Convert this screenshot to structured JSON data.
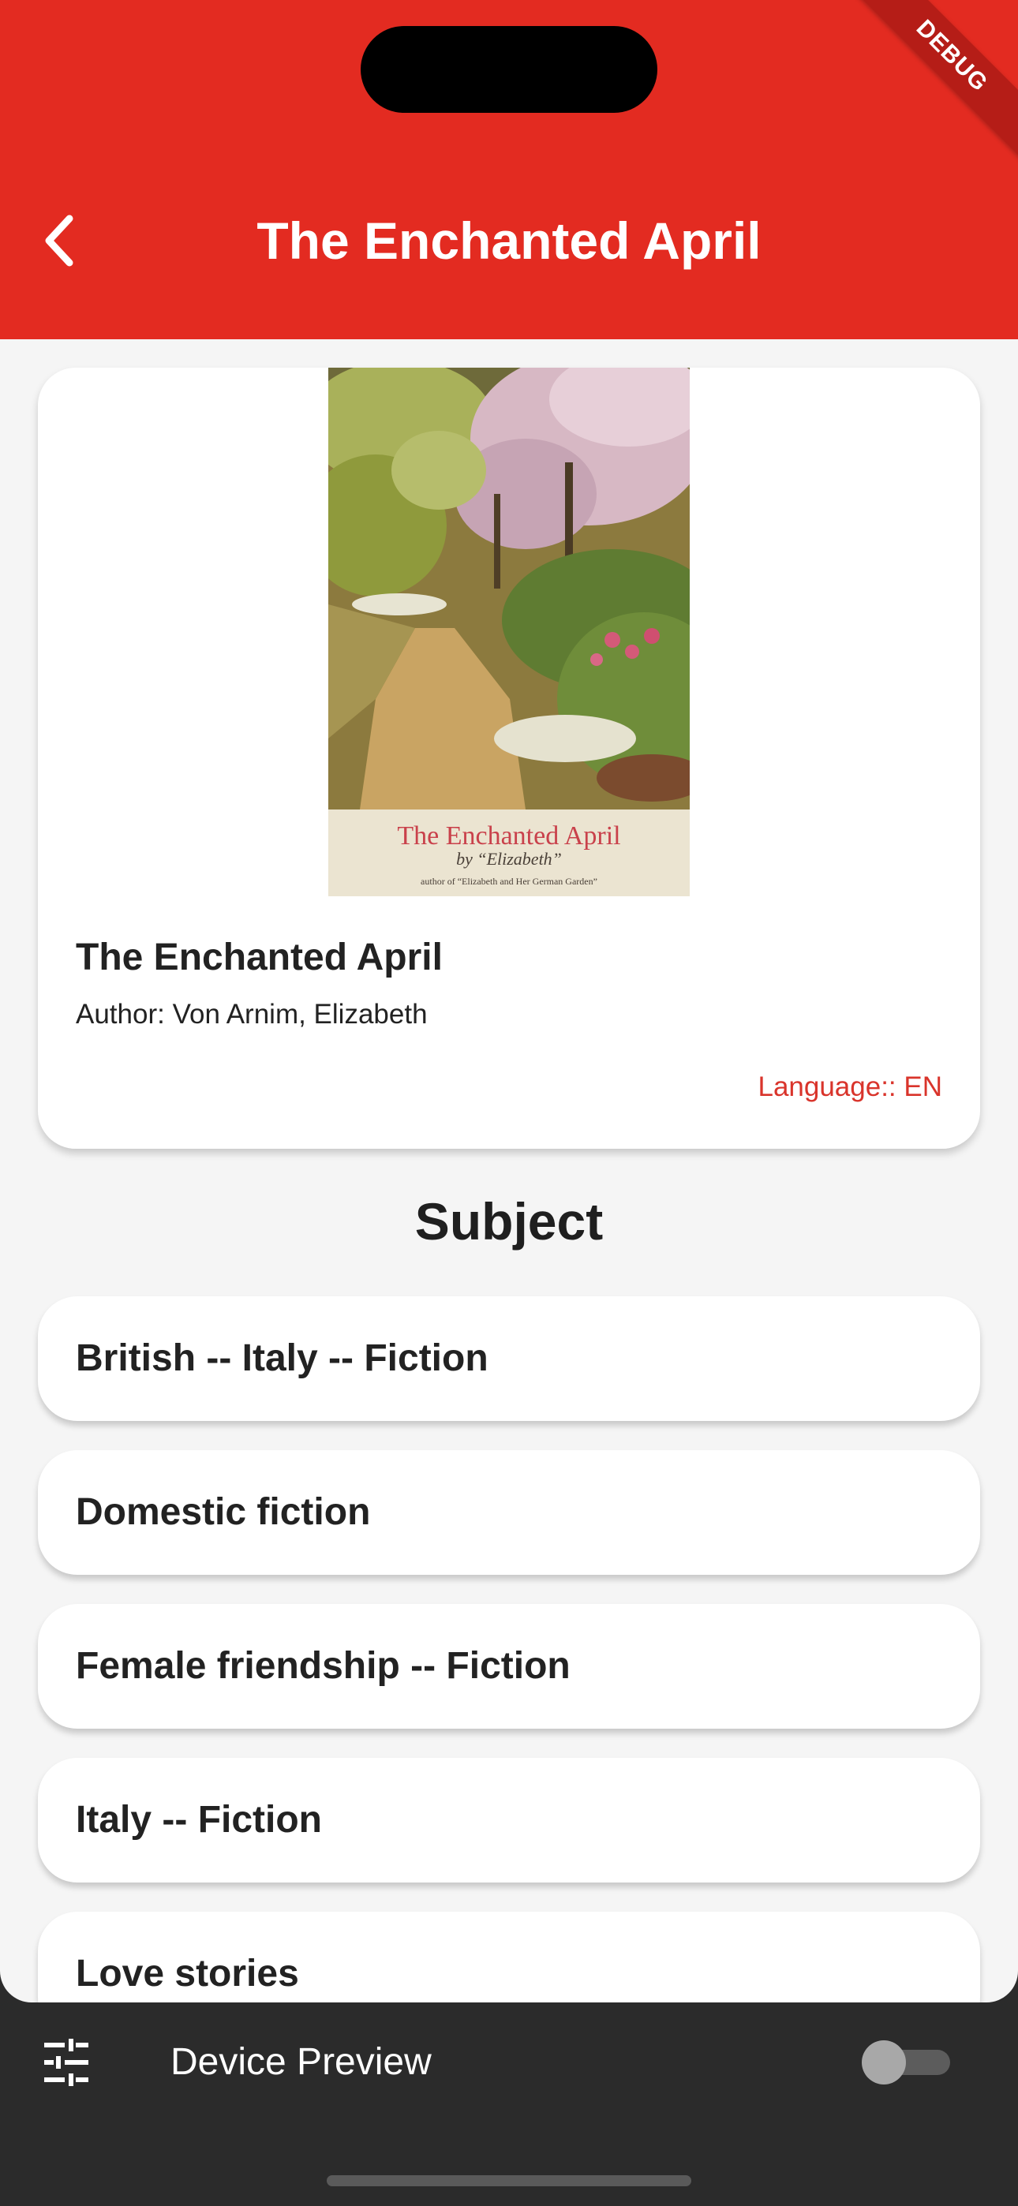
{
  "appbar": {
    "title": "The Enchanted April",
    "back_icon": "chevron-left-icon",
    "debug_banner": "DEBUG",
    "color": "#e32b21"
  },
  "book": {
    "cover_title": "The Enchanted April",
    "cover_byline": "by “Elizabeth”",
    "cover_note": "author of “Elizabeth and Her German Garden”",
    "title": "The Enchanted April",
    "author": "Author: Von Arnim, Elizabeth",
    "language": "Language:: EN"
  },
  "subjects": {
    "heading": "Subject",
    "items": [
      {
        "label": "British -- Italy -- Fiction"
      },
      {
        "label": "Domestic fiction"
      },
      {
        "label": "Female friendship -- Fiction"
      },
      {
        "label": "Italy -- Fiction"
      },
      {
        "label": "Love stories"
      }
    ]
  },
  "device_preview": {
    "settings_icon": "sliders-icon",
    "label": "Device Preview",
    "toggle_on": false
  }
}
